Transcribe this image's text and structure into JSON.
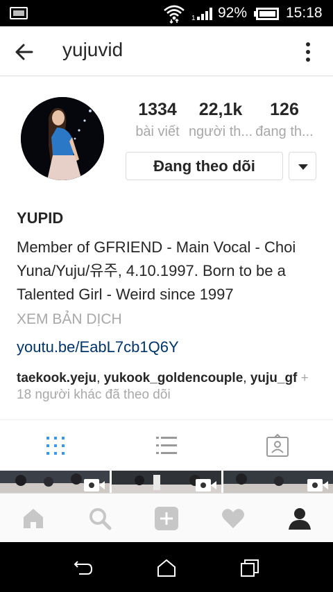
{
  "status_bar": {
    "battery_percent": "92%",
    "time": "15:18"
  },
  "app_bar": {
    "username": "yujuvid",
    "back_icon": "arrow-back-icon",
    "more_icon": "more-vertical-icon"
  },
  "profile": {
    "stats": [
      {
        "value": "1334",
        "label": "bài viết"
      },
      {
        "value": "22,1k",
        "label": "người th..."
      },
      {
        "value": "126",
        "label": "đang th..."
      }
    ],
    "follow_button": "Đang theo dõi",
    "full_name": "YUPID",
    "bio_lines": [
      "Member of GFRIEND - Main Vocal - Choi",
      "Yuna/Yuju/유주, 4.10.1997. Born to be a",
      "Talented Girl - Weird since 1997"
    ],
    "translate_link": "XEM BẢN DỊCH",
    "website": "youtu.be/EabL7cb1Q6Y",
    "followed_by": {
      "users": [
        "taekook.yeju",
        "yukook_goldencouple",
        "yuju_gf"
      ],
      "more_text": "18 người khác đã theo dõi",
      "plus": "+"
    }
  },
  "view_tabs": [
    {
      "icon": "grid-icon",
      "active": true
    },
    {
      "icon": "list-icon",
      "active": false
    },
    {
      "icon": "tagged-photos-icon",
      "active": false
    }
  ],
  "bottom_nav": [
    {
      "icon": "home-icon"
    },
    {
      "icon": "search-icon"
    },
    {
      "icon": "add-post-icon"
    },
    {
      "icon": "activity-heart-icon"
    },
    {
      "icon": "profile-icon"
    }
  ],
  "system_bar": [
    {
      "icon": "system-back-icon"
    },
    {
      "icon": "system-home-icon"
    },
    {
      "icon": "system-recents-icon"
    }
  ],
  "colors": {
    "link": "#003569",
    "active_tab": "#3897f0",
    "muted": "#a8a8a8",
    "text": "#262626"
  }
}
